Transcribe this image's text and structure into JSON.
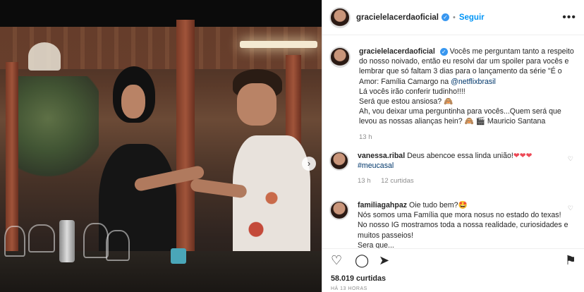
{
  "post": {
    "username": "gracielelacerdaoficial",
    "verified_mark": "✓",
    "separator": "•",
    "follow_label": "Seguir",
    "more_icon": "more-horizontal-icon"
  },
  "caption": {
    "username": "gracielelacerdaoficial",
    "verified_mark": "✓",
    "line1": "Vocês me perguntam tanto a respeito do nosso noivado, então eu resolvi dar um spoiler para vocês e lembrar que só faltam 3 dias para o lançamento da série \"É o Amor: Família Camargo na ",
    "mention": "@netflixbrasil",
    "line2": "Lá vocês irão conferir tudinho!!!!",
    "line3": "Será que estou ansiosa? 🙈",
    "line4": "Ah, vou deixar uma perguntinha para vocês...Quem será que levou as nossas alianças hein? 🙈 🎬 Mauricio Santana",
    "age": "13 h"
  },
  "comments": [
    {
      "username": "vanessa.ribal",
      "text": "Deus abencoe essa linda união!",
      "emoji": "❤❤❤",
      "hashtag": "#meucasal",
      "age": "13 h",
      "likes": "12 curtidas"
    },
    {
      "username": "familiagahpaz",
      "text": "Oie tudo bem?🤩",
      "line2": "Nós somos uma Família que mora nosus   no estado do texas!",
      "line3": "No nosso IG mostramos toda a nossa realidade, curiosidades e muitos passeios!",
      "line4": "Sera que..."
    }
  ],
  "actions": {
    "like_icon": "heart-icon",
    "comment_icon": "comment-icon",
    "share_icon": "share-icon",
    "save_icon": "bookmark-icon"
  },
  "likes": "58.019 curtidas",
  "timestamp": "HÁ 13 HORAS",
  "carousel_next": "›"
}
